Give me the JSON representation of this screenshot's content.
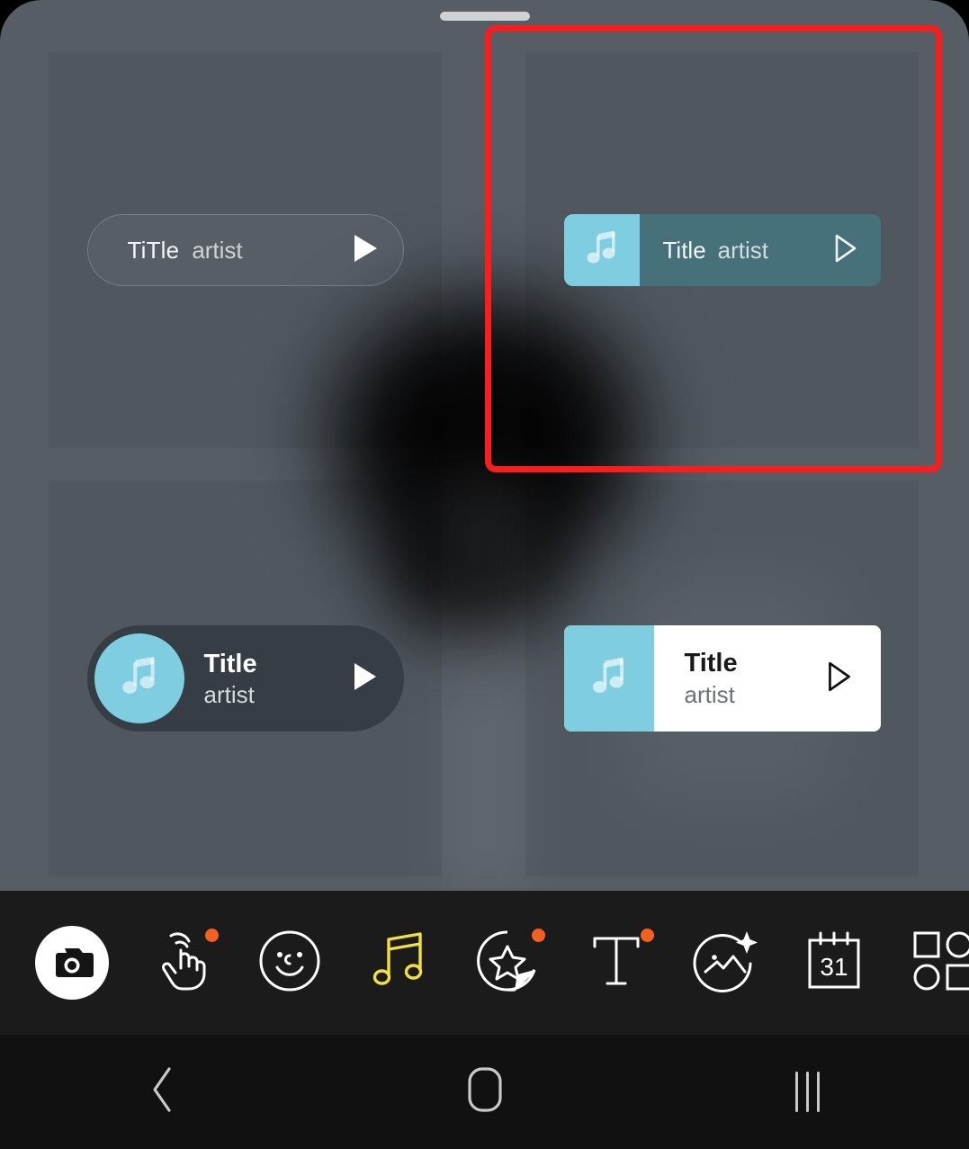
{
  "app": {
    "screen_name": "music-sticker-picker",
    "panel_background": "#565d65",
    "accent_cyan": "#7fcde0",
    "selected_card_bg": "#46707a",
    "annotation_color": "#fa1d1d",
    "toolbar_background": "#1b1b1c",
    "navbar_background": "#111112",
    "badge_color": "#f4601f"
  },
  "handle": {
    "name": "drag-handle"
  },
  "stickers": [
    {
      "id": "sticker-outline-pill",
      "style": "outlined-pill",
      "title": "TiTle",
      "artist": "artist",
      "play_icon": "play-filled-icon",
      "selected": false
    },
    {
      "id": "sticker-teal-card",
      "style": "teal-card",
      "title": "Title",
      "artist": "artist",
      "thumb_icon": "music-note-icon",
      "play_icon": "play-outline-icon",
      "selected": true
    },
    {
      "id": "sticker-dark-pill",
      "style": "dark-pill",
      "title": "Title",
      "artist": "artist",
      "thumb_icon": "music-note-icon",
      "play_icon": "play-filled-icon",
      "selected": false
    },
    {
      "id": "sticker-white-card",
      "style": "white-card",
      "title": "Title",
      "artist": "artist",
      "thumb_icon": "music-note-icon",
      "play_icon": "play-outline-icon",
      "selected": false
    }
  ],
  "annotation": {
    "shape": "rectangle",
    "target": "sticker-teal-card",
    "color": "#fa1d1d"
  },
  "toolbar": {
    "items": [
      {
        "name": "camera-button",
        "icon": "camera-icon",
        "badge": false
      },
      {
        "name": "tap-gesture-button",
        "icon": "hand-tap-icon",
        "badge": true
      },
      {
        "name": "emoji-button",
        "icon": "smiley-face-icon",
        "badge": false
      },
      {
        "name": "music-button",
        "icon": "music-note-icon",
        "badge": false,
        "selected": true,
        "color": "#f3e03a"
      },
      {
        "name": "sticker-button",
        "icon": "star-sticker-icon",
        "badge": true
      },
      {
        "name": "text-button",
        "icon": "text-t-icon",
        "badge": true
      },
      {
        "name": "photo-effects-button",
        "icon": "photo-sparkle-icon",
        "badge": false
      },
      {
        "name": "calendar-button",
        "icon": "calendar-icon",
        "badge": false,
        "label": "31"
      },
      {
        "name": "shapes-button",
        "icon": "shapes-grid-icon",
        "badge": false
      }
    ]
  },
  "navbar": {
    "items": [
      {
        "name": "nav-back-button",
        "icon": "chevron-left-icon"
      },
      {
        "name": "nav-home-button",
        "icon": "home-square-icon"
      },
      {
        "name": "nav-recents-button",
        "icon": "recents-bars-icon"
      }
    ]
  }
}
